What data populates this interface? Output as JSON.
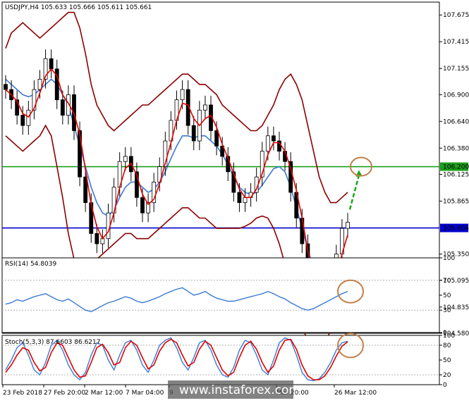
{
  "chart_data": [
    {
      "type": "candlestick",
      "panel": "main",
      "title": "USDJPY,H4  105.633 105.666 105.611 105.661",
      "y_ticks": [
        "107.675",
        "107.415",
        "107.155",
        "106.900",
        "106.640",
        "106.380",
        "106.125",
        "105.865",
        "105.350",
        "105.095",
        "104.835",
        "104.580"
      ],
      "ylim": [
        104.58,
        107.8
      ],
      "levels": [
        {
          "label": "106.200",
          "value": 106.2,
          "color": "#1a9e1a",
          "box_color": "#1a9e1a"
        },
        {
          "label": "105.604",
          "value": 105.604,
          "color": "#0000cc",
          "box_color": "#0000cc"
        }
      ],
      "price_box_partial": "105.661",
      "series": [
        {
          "role": "close",
          "values": [
            106.95,
            106.85,
            106.7,
            106.6,
            106.75,
            106.95,
            107.05,
            107.25,
            107.15,
            106.85,
            106.7,
            106.9,
            106.55,
            106.1,
            105.85,
            105.55,
            105.45,
            105.5,
            105.75,
            106.0,
            106.25,
            106.3,
            106.15,
            105.9,
            105.75,
            105.85,
            106.05,
            106.2,
            106.45,
            106.65,
            106.85,
            106.95,
            106.6,
            106.45,
            106.75,
            106.8,
            106.55,
            106.4,
            106.3,
            106.15,
            105.95,
            105.85,
            105.9,
            105.95,
            106.1,
            106.35,
            106.5,
            106.45,
            106.35,
            106.25,
            105.95,
            105.7,
            105.45,
            105.0,
            104.8,
            104.75,
            104.85,
            105.1,
            105.35,
            105.6,
            105.66
          ]
        },
        {
          "role": "bollinger_upper",
          "values": [
            107.35,
            107.5,
            107.55,
            107.6,
            107.55,
            107.5,
            107.45,
            107.5,
            107.55,
            107.6,
            107.65,
            107.7,
            107.7,
            107.55,
            107.3,
            107.0,
            106.8,
            106.7,
            106.6,
            106.55,
            106.6,
            106.65,
            106.7,
            106.75,
            106.8,
            106.8,
            106.85,
            106.9,
            106.95,
            107.0,
            107.05,
            107.1,
            107.1,
            107.05,
            107.0,
            107.0,
            106.95,
            106.9,
            106.8,
            106.75,
            106.7,
            106.65,
            106.6,
            106.55,
            106.55,
            106.6,
            106.7,
            106.8,
            106.95,
            107.05,
            107.1,
            107.0,
            106.85,
            106.6,
            106.35,
            106.1,
            105.95,
            105.85,
            105.85,
            105.9,
            105.95
          ]
        },
        {
          "role": "bollinger_lower",
          "values": [
            106.5,
            106.45,
            106.4,
            106.35,
            106.4,
            106.45,
            106.5,
            106.6,
            106.5,
            106.2,
            105.9,
            105.55,
            105.3,
            105.15,
            105.15,
            105.2,
            105.3,
            105.35,
            105.4,
            105.45,
            105.5,
            105.55,
            105.55,
            105.5,
            105.5,
            105.5,
            105.55,
            105.6,
            105.65,
            105.7,
            105.75,
            105.8,
            105.8,
            105.75,
            105.7,
            105.7,
            105.65,
            105.6,
            105.6,
            105.6,
            105.6,
            105.6,
            105.62,
            105.65,
            105.7,
            105.72,
            105.7,
            105.6,
            105.45,
            105.25,
            105.05,
            104.85,
            104.65,
            104.5,
            104.45,
            104.45,
            104.5,
            104.6,
            104.7,
            104.8,
            104.85
          ]
        },
        {
          "role": "moving_average",
          "values": [
            107.05,
            107.0,
            106.95,
            106.9,
            106.88,
            106.9,
            106.95,
            107.0,
            107.05,
            107.0,
            106.9,
            106.8,
            106.6,
            106.4,
            106.2,
            106.0,
            105.85,
            105.75,
            105.72,
            105.78,
            105.9,
            106.0,
            106.05,
            106.05,
            106.0,
            105.95,
            105.98,
            106.05,
            106.15,
            106.28,
            106.4,
            106.5,
            106.5,
            106.48,
            106.5,
            106.5,
            106.45,
            106.4,
            106.32,
            106.22,
            106.1,
            106.0,
            105.95,
            105.93,
            105.95,
            106.02,
            106.1,
            106.18,
            106.2,
            106.15,
            106.0,
            105.8,
            105.6,
            105.4,
            105.2,
            105.05,
            104.95,
            104.92,
            104.95,
            105.02,
            105.1
          ]
        }
      ]
    },
    {
      "type": "line",
      "panel": "rsi",
      "title": "RSI(14) 54.8039",
      "y_ticks": [
        "100",
        "70",
        "50",
        "30",
        "0"
      ],
      "ylim": [
        0,
        100
      ],
      "series": [
        {
          "name": "RSI(14)",
          "values": [
            38,
            40,
            44,
            42,
            45,
            48,
            50,
            52,
            48,
            44,
            42,
            45,
            40,
            35,
            30,
            28,
            32,
            36,
            40,
            42,
            45,
            48,
            46,
            42,
            40,
            42,
            45,
            48,
            52,
            55,
            58,
            60,
            55,
            50,
            52,
            55,
            50,
            46,
            44,
            42,
            42,
            44,
            46,
            48,
            50,
            52,
            55,
            52,
            48,
            45,
            40,
            36,
            32,
            30,
            32,
            36,
            40,
            44,
            48,
            52,
            55
          ]
        }
      ]
    },
    {
      "type": "line",
      "panel": "stochastic",
      "title": "Stoch(5,3,3) 87.6603 86.6217",
      "y_ticks": [
        "100",
        "80",
        "50",
        "20",
        "0"
      ],
      "ylim": [
        0,
        100
      ],
      "series": [
        {
          "name": "%K",
          "values": [
            30,
            50,
            75,
            85,
            60,
            30,
            20,
            45,
            80,
            90,
            70,
            40,
            20,
            10,
            25,
            60,
            85,
            80,
            50,
            30,
            60,
            85,
            90,
            70,
            40,
            25,
            50,
            80,
            90,
            95,
            75,
            45,
            30,
            55,
            85,
            90,
            70,
            40,
            20,
            15,
            35,
            70,
            90,
            85,
            60,
            30,
            20,
            50,
            85,
            95,
            90,
            60,
            25,
            10,
            8,
            12,
            25,
            45,
            70,
            85,
            88
          ]
        },
        {
          "name": "%D",
          "values": [
            25,
            40,
            60,
            75,
            70,
            45,
            28,
            35,
            65,
            85,
            80,
            55,
            30,
            15,
            18,
            45,
            75,
            82,
            65,
            40,
            45,
            75,
            88,
            80,
            55,
            32,
            40,
            68,
            85,
            92,
            85,
            60,
            38,
            45,
            72,
            88,
            80,
            55,
            30,
            18,
            25,
            55,
            80,
            88,
            72,
            45,
            25,
            38,
            70,
            90,
            92,
            72,
            40,
            18,
            10,
            10,
            18,
            35,
            58,
            78,
            87
          ]
        }
      ]
    }
  ],
  "x_ticks": [
    "23 Feb 2018",
    "27 Feb 20:00",
    "2 Mar 12:00",
    "7 Mar 04:00",
    "9",
    "Mar 20:00",
    "26 Mar 12:00"
  ],
  "watermark": "www.instaforex.com"
}
